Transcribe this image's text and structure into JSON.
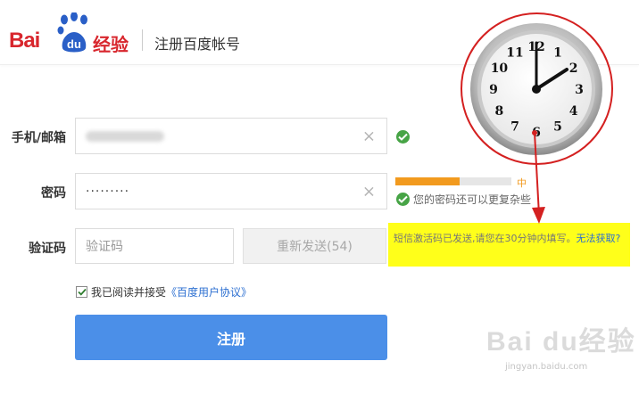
{
  "header": {
    "logo_text": "Bai",
    "logo_du": "du",
    "logo_suffix": "经验",
    "title": "注册百度帐号"
  },
  "form": {
    "phone_label": "手机/邮箱",
    "password_label": "密码",
    "password_dots": "·········",
    "password_strength": {
      "level_text": "中",
      "level": 0.55,
      "color": "#f29a1e"
    },
    "password_hint": "您的密码还可以更复杂些",
    "code_label": "验证码",
    "code_placeholder": "验证码",
    "resend_label": "重新发送(54)",
    "sms_note": "短信激活码已发送,请您在30分钟内填写。",
    "sms_note_link": "无法获取?",
    "agree_text": "我已阅读并接受",
    "agree_link": "《百度用户协议》",
    "submit_label": "注册",
    "clear_icon": "×"
  },
  "clock": {
    "numbers": [
      "12",
      "1",
      "2",
      "3",
      "4",
      "5",
      "6",
      "7",
      "8",
      "9",
      "10",
      "11"
    ]
  },
  "watermark": {
    "text": "Bai du经验",
    "sub": "jingyan.baidu.com"
  },
  "colors": {
    "brand_red": "#d8262d",
    "primary_blue": "#4b8fe8",
    "ok_green": "#47a446",
    "note_yellow": "#ffff1a",
    "annotation_red": "#d42020"
  }
}
